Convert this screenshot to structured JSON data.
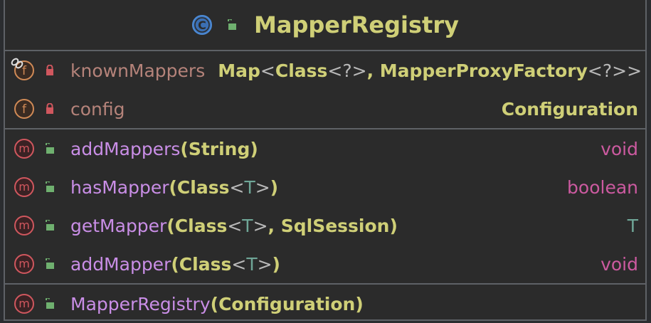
{
  "header": {
    "title": "MapperRegistry"
  },
  "fields": [
    {
      "name": "knownMappers",
      "type_parts": [
        "Map",
        "<",
        "Class",
        "<?>",
        ", ",
        "MapperProxyFactory",
        "<?>>"
      ],
      "inline": true
    },
    {
      "name": "config",
      "type": "Configuration"
    }
  ],
  "methods": [
    {
      "name": "addMappers",
      "params": "(String)",
      "param_type": "String",
      "return": "void"
    },
    {
      "name": "hasMapper",
      "param_type": "Class",
      "generic": "T",
      "return": "boolean"
    },
    {
      "name": "getMapper",
      "param_type": "Class",
      "generic": "T",
      "param_type2": "SqlSession",
      "return": "T"
    },
    {
      "name": "addMapper",
      "param_type": "Class",
      "generic": "T",
      "return": "void"
    }
  ],
  "constructors": [
    {
      "name": "MapperRegistry",
      "param_type": "Configuration"
    }
  ],
  "icons": {
    "class_badge": "C",
    "field_badge": "f",
    "method_badge": "m"
  },
  "colors": {
    "title": "#cfcf77",
    "field_name": "#b5837a",
    "method_name": "#c98ee6",
    "keyword": "#cc5aa0",
    "generic": "#6fa697"
  }
}
